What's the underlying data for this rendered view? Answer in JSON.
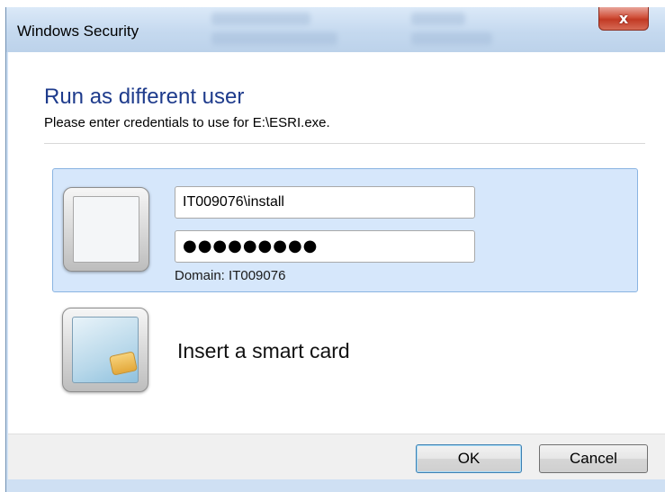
{
  "window": {
    "title": "Windows Security",
    "close_glyph": "x"
  },
  "dialog": {
    "heading": "Run as different user",
    "subheading": "Please enter credentials to use for E:\\ESRI.exe."
  },
  "credential": {
    "username_value": "IT009076\\install",
    "password_masked": "●●●●●●●●●",
    "domain_label": "Domain: IT009076"
  },
  "smartcard": {
    "label": "Insert a smart card"
  },
  "buttons": {
    "ok": "OK",
    "cancel": "Cancel"
  },
  "icons": {
    "user": "user-tile-icon",
    "smartcard": "smart-card-icon",
    "close": "close-icon"
  },
  "colors": {
    "heading": "#1e3b8c",
    "panel": "#d6e7fb",
    "close_button": "#c23a24"
  }
}
